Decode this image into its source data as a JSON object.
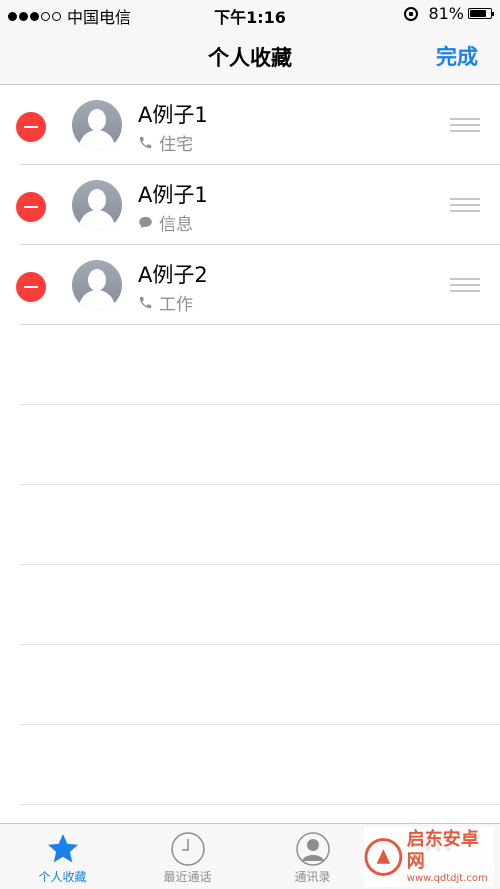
{
  "status_bar": {
    "carrier": "中国电信",
    "signal_filled": 3,
    "signal_total": 5,
    "time": "下午1:16",
    "battery_percent": "81%",
    "battery_level": 0.81
  },
  "nav": {
    "title": "个人收藏",
    "done_label": "完成"
  },
  "favorites": [
    {
      "name": "A例子1",
      "type_label": "住宅",
      "type_icon": "phone-icon"
    },
    {
      "name": "A例子1",
      "type_label": "信息",
      "type_icon": "message-icon"
    },
    {
      "name": "A例子2",
      "type_label": "工作",
      "type_icon": "phone-icon"
    }
  ],
  "tabs": [
    {
      "label": "个人收藏",
      "icon": "star-icon",
      "active": true
    },
    {
      "label": "最近通话",
      "icon": "clock-icon",
      "active": false
    },
    {
      "label": "通讯录",
      "icon": "contacts-icon",
      "active": false
    },
    {
      "label": "",
      "icon": "keypad-icon",
      "active": false
    }
  ],
  "watermark": {
    "name": "启东安卓网",
    "url": "www.qdtdjt.com"
  },
  "colors": {
    "accent": "#1a80ea",
    "delete": "#fc3d39",
    "secondary_text": "#8e8e93"
  }
}
